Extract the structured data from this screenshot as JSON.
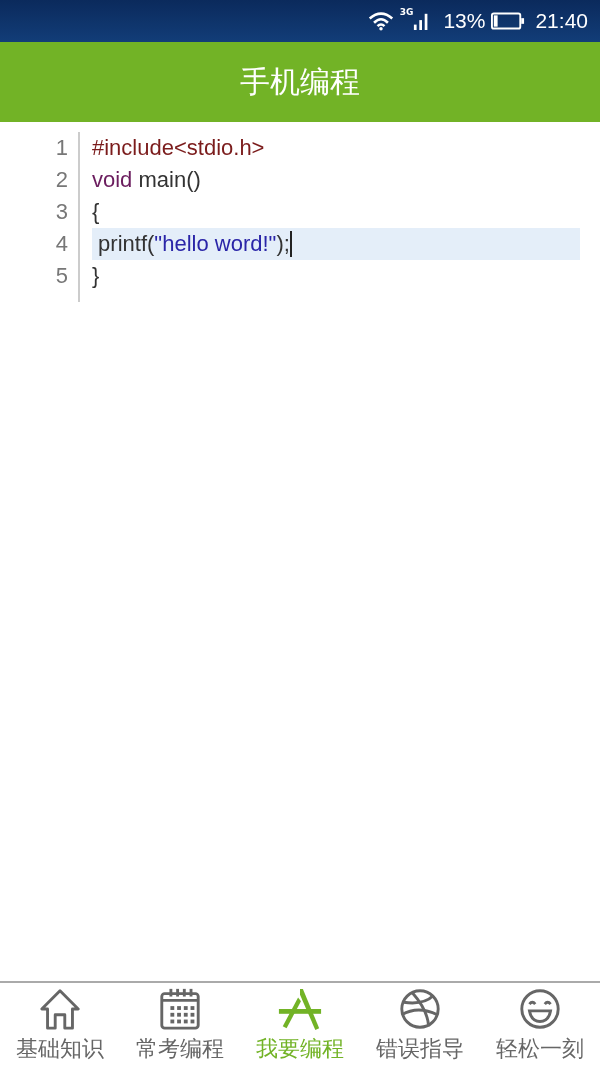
{
  "status_bar": {
    "network": "3G",
    "battery": "13%",
    "time": "21:40"
  },
  "header": {
    "title": "手机编程"
  },
  "editor": {
    "lines": [
      {
        "number": "1",
        "current": false,
        "tokens": [
          {
            "kind": "preprocessor",
            "text": "#include<stdio.h>"
          }
        ]
      },
      {
        "number": "2",
        "current": false,
        "tokens": [
          {
            "kind": "keyword",
            "text": "void"
          },
          {
            "kind": "plain",
            "text": " main()"
          }
        ]
      },
      {
        "number": "3",
        "current": false,
        "tokens": [
          {
            "kind": "plain",
            "text": "{"
          }
        ]
      },
      {
        "number": "4",
        "current": true,
        "tokens": [
          {
            "kind": "plain",
            "text": " printf("
          },
          {
            "kind": "string",
            "text": "\"hello word!\""
          },
          {
            "kind": "plain",
            "text": ");"
          }
        ]
      },
      {
        "number": "5",
        "current": false,
        "tokens": [
          {
            "kind": "plain",
            "text": "}"
          }
        ]
      }
    ]
  },
  "tabs": [
    {
      "kind": "home",
      "label": "基础知识",
      "selected": false
    },
    {
      "kind": "calendar",
      "label": "常考编程",
      "selected": false
    },
    {
      "kind": "appstore",
      "label": "我要编程",
      "selected": true
    },
    {
      "kind": "ball",
      "label": "错误指导",
      "selected": false
    },
    {
      "kind": "smile",
      "label": "轻松一刻",
      "selected": false
    }
  ]
}
